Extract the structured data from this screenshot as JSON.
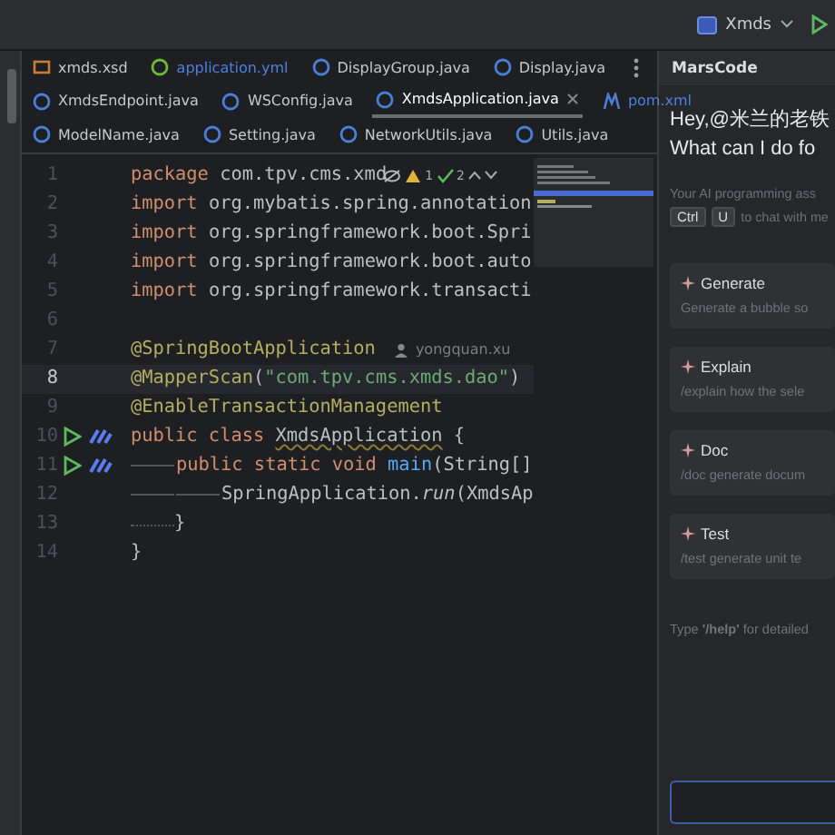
{
  "toolbar": {
    "project": "Xmds"
  },
  "tab_rows": [
    [
      {
        "label": "xmds.xsd",
        "kind": "xsd",
        "selected": false
      },
      {
        "label": "application.yml",
        "kind": "yml",
        "selected": false
      },
      {
        "label": "DisplayGroup.java",
        "kind": "java",
        "selected": false
      },
      {
        "label": "Display.java",
        "kind": "java",
        "selected": false
      }
    ],
    [
      {
        "label": "XmdsEndpoint.java",
        "kind": "java",
        "selected": false
      },
      {
        "label": "WSConfig.java",
        "kind": "java",
        "selected": false
      },
      {
        "label": "XmdsApplication.java",
        "kind": "java",
        "selected": true
      },
      {
        "label": "pom.xml",
        "kind": "maven",
        "selected": false
      }
    ],
    [
      {
        "label": "ModelName.java",
        "kind": "java",
        "selected": false
      },
      {
        "label": "Setting.java",
        "kind": "java",
        "selected": false
      },
      {
        "label": "NetworkUtils.java",
        "kind": "java",
        "selected": false
      },
      {
        "label": "Utils.java",
        "kind": "java",
        "selected": false
      }
    ]
  ],
  "editor": {
    "inspections": {
      "warnings": "1",
      "checks": "2"
    },
    "lines": [
      {
        "number": "1",
        "current": false,
        "gutter_actions": false,
        "tokens": [
          {
            "kind": "keyword",
            "text": "package"
          },
          {
            "kind": "plain",
            "text": " com.tpv.cms.xmd"
          }
        ]
      },
      {
        "number": "2",
        "current": false,
        "gutter_actions": false,
        "tokens": [
          {
            "kind": "keyword",
            "text": "import"
          },
          {
            "kind": "plain",
            "text": " org.mybatis.spring.annotation"
          }
        ]
      },
      {
        "number": "3",
        "current": false,
        "gutter_actions": false,
        "tokens": [
          {
            "kind": "keyword",
            "text": "import"
          },
          {
            "kind": "plain",
            "text": " org.springframework.boot.Spri"
          }
        ]
      },
      {
        "number": "4",
        "current": false,
        "gutter_actions": false,
        "tokens": [
          {
            "kind": "keyword",
            "text": "import"
          },
          {
            "kind": "plain",
            "text": " org.springframework.boot.auto"
          }
        ]
      },
      {
        "number": "5",
        "current": false,
        "gutter_actions": false,
        "tokens": [
          {
            "kind": "keyword",
            "text": "import"
          },
          {
            "kind": "plain",
            "text": " org.springframework.transacti"
          }
        ]
      },
      {
        "number": "6",
        "current": false,
        "gutter_actions": false
      },
      {
        "number": "7",
        "current": false,
        "gutter_actions": false,
        "author": "yongquan.xu",
        "tokens": [
          {
            "kind": "annotation",
            "text": "@SpringBootApplication"
          }
        ]
      },
      {
        "number": "8",
        "current": true,
        "gutter_actions": false,
        "tokens": [
          {
            "kind": "annotation",
            "text": "@MapperScan"
          },
          {
            "kind": "plain",
            "text": "("
          },
          {
            "kind": "string",
            "text": "\"com.tpv.cms.xmds.dao\""
          },
          {
            "kind": "plain",
            "text": ")"
          }
        ]
      },
      {
        "number": "9",
        "current": false,
        "gutter_actions": false,
        "tokens": [
          {
            "kind": "annotation",
            "text": "@EnableTransactionManagement"
          }
        ]
      },
      {
        "number": "10",
        "current": false,
        "gutter_actions": true,
        "tokens": [
          {
            "kind": "keyword",
            "text": "public class "
          },
          {
            "kind": "warning",
            "text": "XmdsApplication"
          },
          {
            "kind": "plain",
            "text": " {"
          }
        ]
      },
      {
        "number": "11",
        "current": false,
        "gutter_actions": true,
        "tokens": [
          {
            "kind": "indent"
          },
          {
            "kind": "keyword",
            "text": "public static void "
          },
          {
            "kind": "method",
            "text": "main"
          },
          {
            "kind": "plain",
            "text": "(String[]"
          }
        ]
      },
      {
        "number": "12",
        "current": false,
        "gutter_actions": false,
        "tokens": [
          {
            "kind": "indent"
          },
          {
            "kind": "indent"
          },
          {
            "kind": "plain",
            "text": "SpringApplication."
          },
          {
            "kind": "static",
            "text": "run"
          },
          {
            "kind": "plain",
            "text": "(XmdsAp"
          }
        ]
      },
      {
        "number": "13",
        "current": false,
        "gutter_actions": false,
        "tokens": [
          {
            "kind": "dots"
          },
          {
            "kind": "plain",
            "text": "}"
          }
        ]
      },
      {
        "number": "14",
        "current": false,
        "gutter_actions": false,
        "tokens": [
          {
            "kind": "plain",
            "text": "}"
          }
        ]
      }
    ]
  },
  "assistant": {
    "title": "MarsCode",
    "greeting": [
      "Hey,@米兰的老铁",
      "What can I do fo"
    ],
    "intro": "Your AI programming ass",
    "shortcut_keys": [
      "Ctrl",
      "U"
    ],
    "shortcut_text": "to chat with me",
    "commands": [
      {
        "name": "Generate",
        "description": "Generate a bubble so"
      },
      {
        "name": "Explain",
        "description": "/explain how the sele"
      },
      {
        "name": "Doc",
        "description": "/doc generate docum"
      },
      {
        "name": "Test",
        "description": "/test generate unit te"
      }
    ],
    "help": "Type **'/help'** for detailed"
  }
}
